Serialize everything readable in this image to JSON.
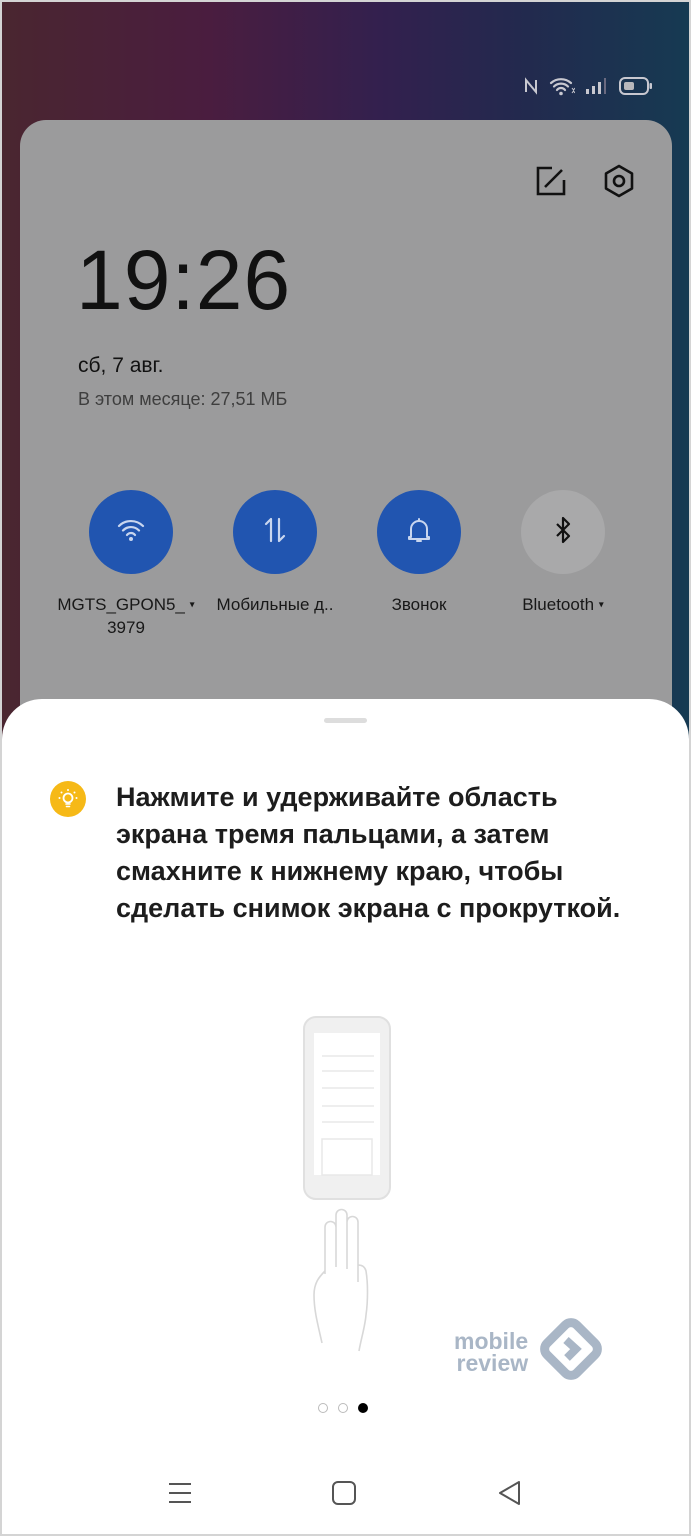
{
  "status_bar": {
    "icons": [
      "nfc-icon",
      "wifi-icon",
      "cellular-signal-icon",
      "battery-icon"
    ]
  },
  "quick_panel": {
    "header_icons": [
      "edit-icon",
      "settings-icon"
    ],
    "time": "19:26",
    "date": "сб, 7 авг.",
    "data_usage": "В этом месяце: 27,51 МБ",
    "tiles": [
      {
        "label": "MGTS_GPON5_",
        "label2": "3979",
        "icon": "wifi-icon",
        "active": true,
        "has_dropdown": true
      },
      {
        "label": "Мобильные д..",
        "icon": "mobile-data-icon",
        "active": true,
        "has_dropdown": false
      },
      {
        "label": "Звонок",
        "icon": "bell-icon",
        "active": true,
        "has_dropdown": false
      },
      {
        "label": "Bluetooth",
        "icon": "bluetooth-icon",
        "active": false,
        "has_dropdown": true
      }
    ],
    "colors": {
      "active_tile": "#2155b0",
      "inactive_tile": "#a9a9aa",
      "panel": "#9b9b9c"
    }
  },
  "tutorial_sheet": {
    "tip_icon": "lightbulb-icon",
    "tip_color": "#f6b917",
    "message": "Нажмите и удерживайте область экрана тремя пальцами, а затем смахните к нижнему краю, чтобы сделать снимок экрана с прокруткой.",
    "illustration": "three-finger-swipe-illustration",
    "page_indicator": {
      "total": 3,
      "current": 3
    }
  },
  "watermark": {
    "line1": "mobile",
    "line2": "review"
  },
  "nav_bar": {
    "buttons": [
      "menu-button",
      "home-button",
      "back-button"
    ]
  }
}
